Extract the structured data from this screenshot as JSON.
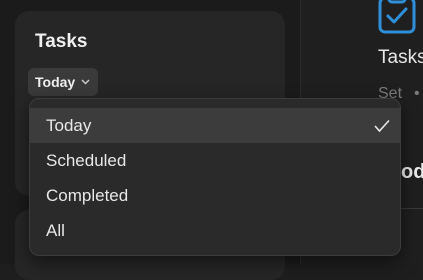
{
  "tasks_card": {
    "title": "Tasks",
    "filter": {
      "label": "Today",
      "icon": "chevron-down-icon"
    }
  },
  "dropdown": {
    "options": [
      {
        "label": "Today",
        "selected": true
      },
      {
        "label": "Scheduled",
        "selected": false
      },
      {
        "label": "Completed",
        "selected": false
      },
      {
        "label": "All",
        "selected": false
      }
    ]
  },
  "right_panel": {
    "icon": "clipboard-check-icon",
    "title": "Tasks",
    "meta": "Set",
    "meta_separator": "•",
    "heading": "oda"
  },
  "colors": {
    "accent": "#2f8fd8",
    "background": "#1e1e1e",
    "card": "#262626"
  }
}
